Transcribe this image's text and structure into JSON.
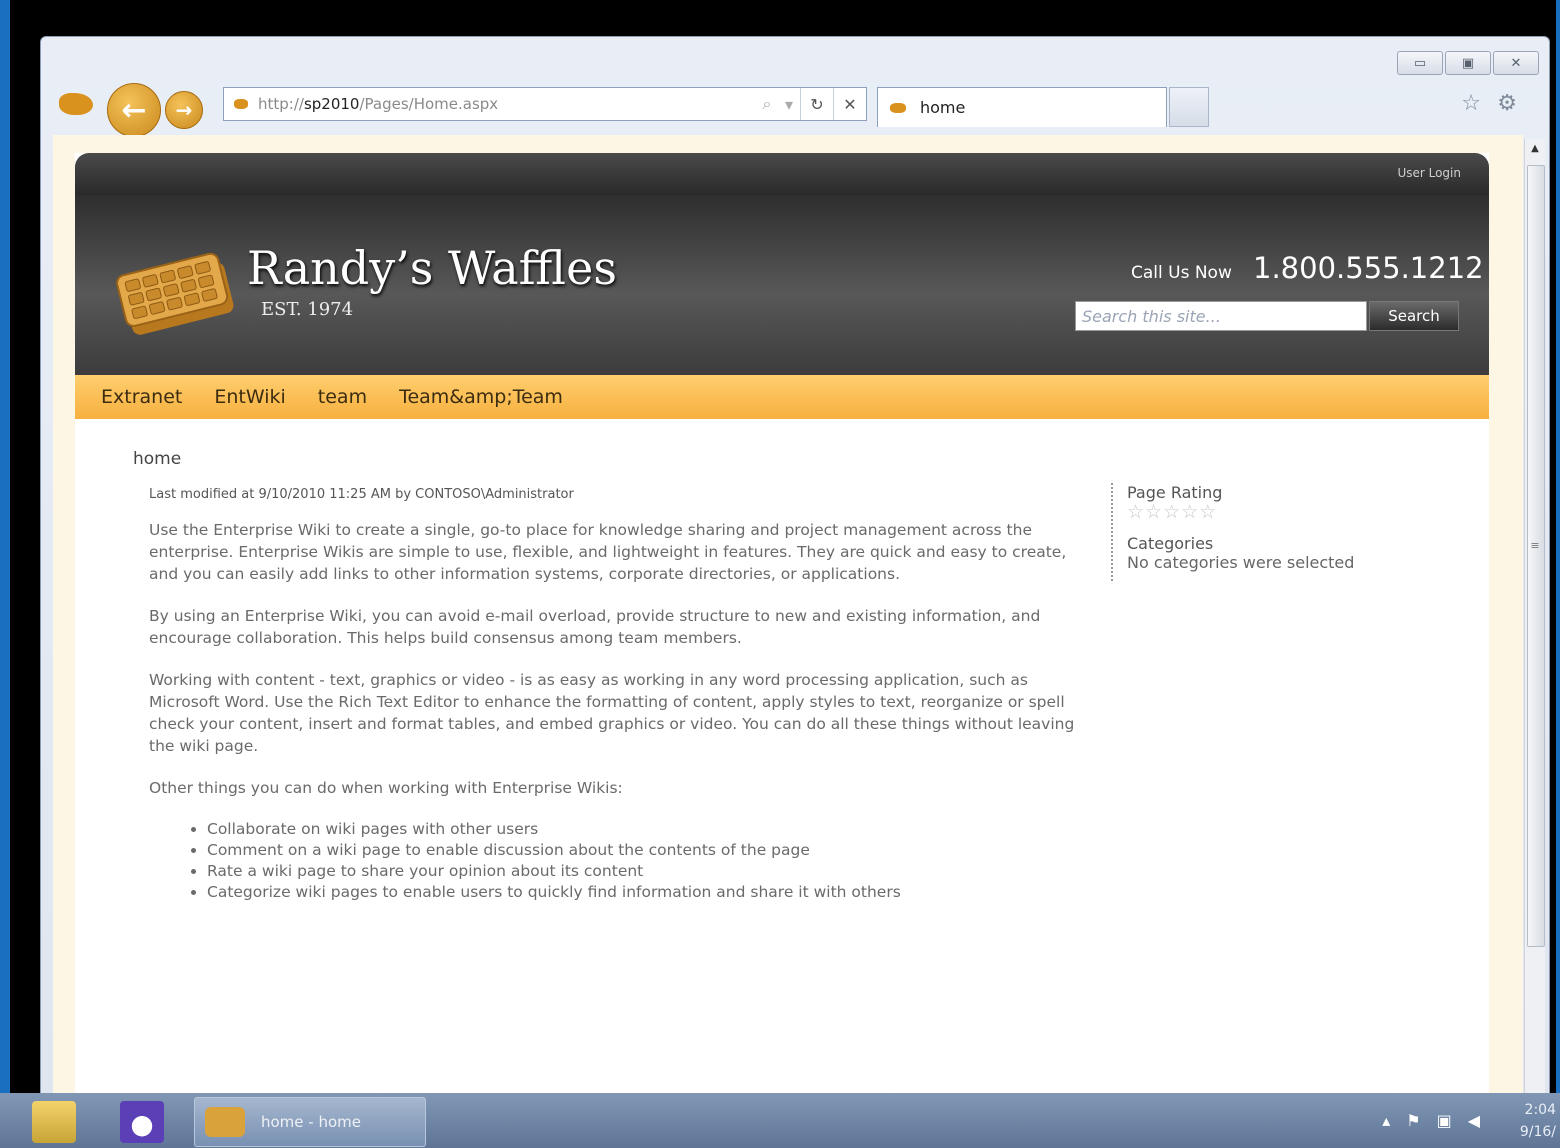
{
  "browser": {
    "url_prefix": "http://",
    "url_host": "sp2010",
    "url_path": "/Pages/Home.aspx",
    "tab_title": "home",
    "window_buttons": [
      "▭",
      "▣",
      "✕"
    ]
  },
  "site": {
    "user_login": "User Login",
    "brand_name": "Randy’s Waffles",
    "brand_est": "EST. 1974",
    "call_label": "Call Us Now",
    "phone": "1.800.555.1212",
    "search_placeholder": "Search this site...",
    "search_button": "Search",
    "nav": [
      "Extranet",
      "EntWiki",
      "team",
      "Team&amp;Team"
    ]
  },
  "page": {
    "breadcrumb": "home",
    "modified": "Last modified at 9/10/2010 11:25 AM by CONTOSO\\Administrator",
    "paragraphs": [
      "Use the Enterprise Wiki to create a single, go-to place for knowledge sharing and project management across the enterprise. Enterprise Wikis are simple to use, flexible, and lightweight in features. They are quick and easy to create, and you can easily add links to other information systems, corporate directories, or applications.",
      "By using an Enterprise Wiki, you can avoid e-mail overload, provide structure to new and existing information, and encourage collaboration. This helps build consensus among team members.",
      "Working with content - text, graphics or video - is as easy as working in any word processing application, such as Microsoft Word. Use the Rich Text Editor to enhance the formatting of content, apply styles to text, reorganize or spell check your content, insert and format tables, and embed graphics or video. You can do all these things without leaving the wiki page.",
      "Other things you can do when working with Enterprise Wikis:"
    ],
    "bullets": [
      "Collaborate on wiki pages with other users",
      "Comment on a wiki page to enable discussion about the contents of the page",
      "Rate a wiki page to share your opinion about its content",
      "Categorize wiki pages to enable users to quickly find information and share it with others"
    ],
    "rating_heading": "Page Rating",
    "rating_value": 0,
    "rating_max": 5,
    "categories_heading": "Categories",
    "categories_value": "No categories were selected"
  },
  "taskbar": {
    "task_label": "home - home",
    "clock_time": "2:04",
    "clock_date": "9/16/"
  },
  "colors": {
    "nav_bar": "#f6b03f",
    "header_dark": "#3c3c3c",
    "browser_accent": "#d9921e"
  }
}
